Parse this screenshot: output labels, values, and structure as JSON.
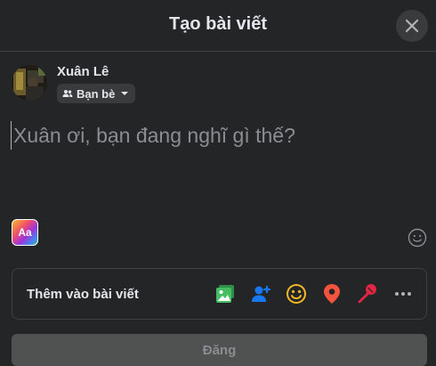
{
  "dialog": {
    "title": "Tạo bài viết"
  },
  "user": {
    "name": "Xuân Lê",
    "audience": "Bạn bè"
  },
  "composer": {
    "placeholder": "Xuân ơi, bạn đang nghĩ gì thế?"
  },
  "text_background_button": {
    "label": "Aa"
  },
  "add_to_post": {
    "label": "Thêm vào bài viết",
    "icons": [
      "photo-video-icon",
      "tag-people-icon",
      "feeling-activity-icon",
      "check-in-icon",
      "live-video-icon",
      "more-icon"
    ]
  },
  "post_button": {
    "label": "Đăng"
  },
  "colors": {
    "background": "#242526",
    "photo": "#45bd62",
    "tag": "#1877f2",
    "feeling": "#f7b928",
    "checkin": "#f5533d",
    "live": "#e42645"
  }
}
